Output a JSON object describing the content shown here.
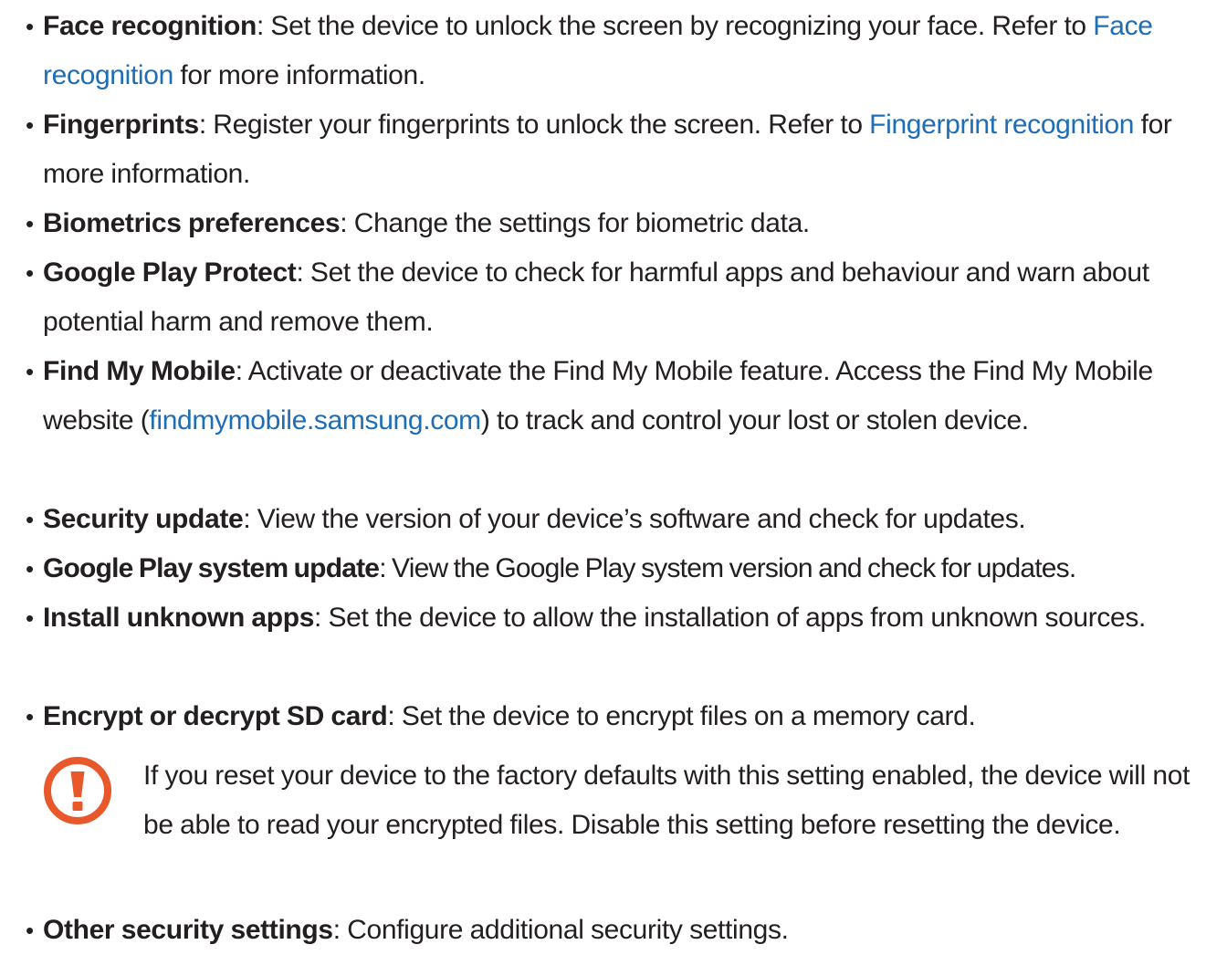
{
  "items": [
    {
      "term": "Face recognition",
      "desc": ": Set the device to unlock the screen by recognizing your face. Refer to ",
      "link": "Face recognition",
      "after": " for more information."
    },
    {
      "term": "Fingerprints",
      "desc": ": Register your fingerprints to unlock the screen. Refer to ",
      "link": "Fingerprint recognition",
      "after": " for more information."
    },
    {
      "term": "Biometrics preferences",
      "desc": ": Change the settings for biometric data."
    },
    {
      "term": "Google Play Protect",
      "desc": ": Set the device to check for harmful apps and behaviour and warn about potential harm and remove them."
    },
    {
      "term": "Find My Mobile",
      "desc": ": Activate or deactivate the Find My Mobile feature. Access the Find My Mobile website (",
      "link": "findmymobile.samsung.com",
      "after": ") to track and control your lost or stolen device."
    },
    {
      "term": "Security update",
      "desc": ": View the version of your device’s software and check for updates."
    },
    {
      "term": "Google Play system update",
      "desc": ": View the Google Play system version and check for updates."
    },
    {
      "term": "Install unknown apps",
      "desc": ": Set the device to allow the installation of apps from unknown sources."
    },
    {
      "term": "Encrypt or decrypt SD card",
      "desc": ": Set the device to encrypt files on a memory card."
    },
    {
      "term": "Other security settings",
      "desc": ": Configure additional security settings."
    }
  ],
  "caution": {
    "text": "If you reset your device to the factory defaults with this setting enabled, the device will not be able to read your encrypted files. Disable this setting before resetting the device.",
    "icon": "caution-icon",
    "color": "#e8582a"
  },
  "bullet_glyph": "•",
  "link_color": "#1f6db5"
}
